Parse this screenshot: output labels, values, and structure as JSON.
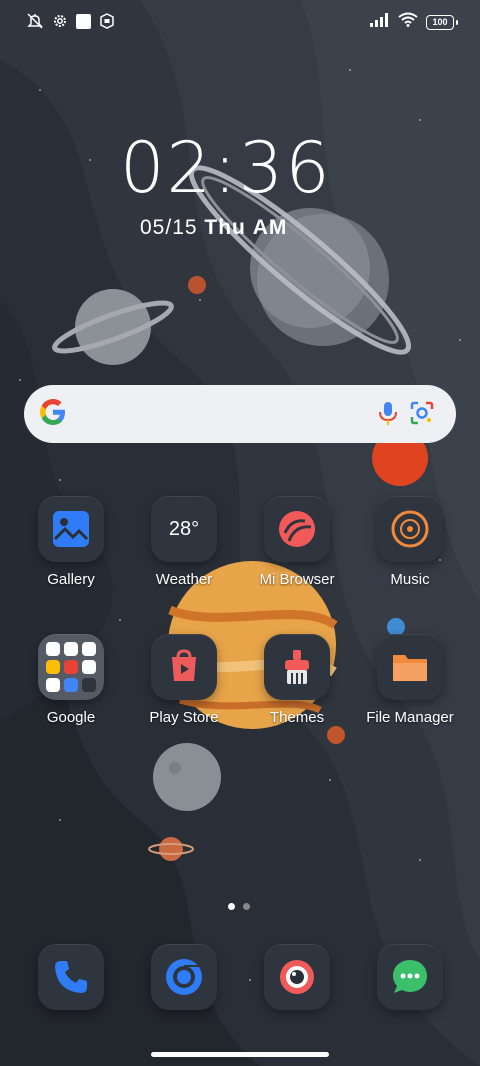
{
  "status_bar": {
    "left_icons": [
      "mute-vibrate-icon",
      "settings-gear-icon",
      "square-notification-icon",
      "shield-notification-icon"
    ],
    "right_icons": [
      "signal-icon",
      "wifi-icon",
      "battery-icon"
    ],
    "battery_level": "100"
  },
  "clock": {
    "time": "02:36",
    "date": "05/15",
    "weekday": "Thu",
    "meridiem": "AM"
  },
  "search_bar": {
    "icons": [
      "google-g-icon",
      "microphone-icon",
      "lens-icon"
    ]
  },
  "apps": [
    {
      "label": "Gallery",
      "icon": "gallery-icon",
      "color": "#2f7cf6"
    },
    {
      "label": "Weather",
      "icon": "weather-icon",
      "value": "28°"
    },
    {
      "label": "Mi Browser",
      "icon": "browser-icon",
      "color": "#f25a5a"
    },
    {
      "label": "Music",
      "icon": "music-icon",
      "color": "#f28a3c"
    },
    {
      "label": "Google",
      "icon": "folder-icon"
    },
    {
      "label": "Play Store",
      "icon": "play-store-icon",
      "color": "#ee5b5b"
    },
    {
      "label": "Themes",
      "icon": "themes-icon",
      "color": "#f25a5a"
    },
    {
      "label": "File Manager",
      "icon": "file-manager-icon",
      "color": "#f28a3c"
    }
  ],
  "page_indicator": {
    "pages": 2,
    "current": 1
  },
  "dock": [
    {
      "icon": "phone-icon",
      "color": "#2f7cf6"
    },
    {
      "icon": "chrome-icon",
      "color": "#2f7cf6"
    },
    {
      "icon": "camera-icon",
      "color": "#f25a5a"
    },
    {
      "icon": "messages-icon",
      "color": "#3cbf6a"
    }
  ]
}
